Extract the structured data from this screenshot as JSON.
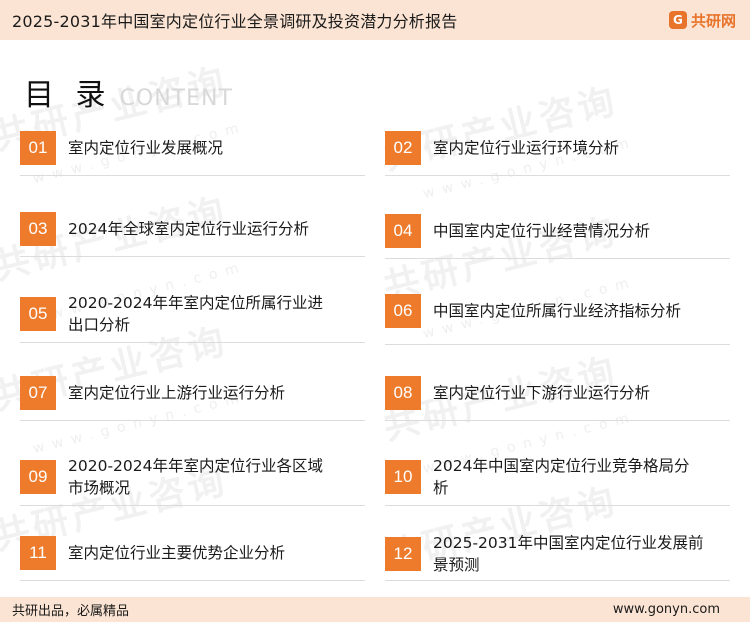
{
  "header": {
    "title": "2025-2031年中国室内定位行业全景调研及投资潜力分析报告",
    "brand_name": "共研网",
    "brand_mark": "G",
    "brand_color": "#e8742c",
    "background_color": "#fbe4d3"
  },
  "toc": {
    "heading": "目 录",
    "heading_en": "CONTENT",
    "accent_color": "#ed7b2b",
    "items": [
      {
        "num": "01",
        "label": "室内定位行业发展概况"
      },
      {
        "num": "02",
        "label": "室内定位行业运行环境分析"
      },
      {
        "num": "03",
        "label": "2024年全球室内定位行业运行分析"
      },
      {
        "num": "04",
        "label": "中国室内定位行业经营情况分析"
      },
      {
        "num": "05",
        "label": "2020-2024年年室内定位所属行业进出口分析"
      },
      {
        "num": "06",
        "label": "中国室内定位所属行业经济指标分析"
      },
      {
        "num": "07",
        "label": "室内定位行业上游行业运行分析"
      },
      {
        "num": "08",
        "label": "室内定位行业下游行业运行分析"
      },
      {
        "num": "09",
        "label": "2020-2024年年室内定位行业各区域市场概况"
      },
      {
        "num": "10",
        "label": "2024年中国室内定位行业竞争格局分析"
      },
      {
        "num": "11",
        "label": "室内定位行业主要优势企业分析"
      },
      {
        "num": "12",
        "label": "2025-2031年中国室内定位行业发展前景预测"
      }
    ]
  },
  "watermark": {
    "text": "共研产业咨询",
    "subtext": "www.gonyn.com"
  },
  "footer": {
    "slogan": "共研出品，必属精品",
    "website": "www.gonyn.com"
  }
}
